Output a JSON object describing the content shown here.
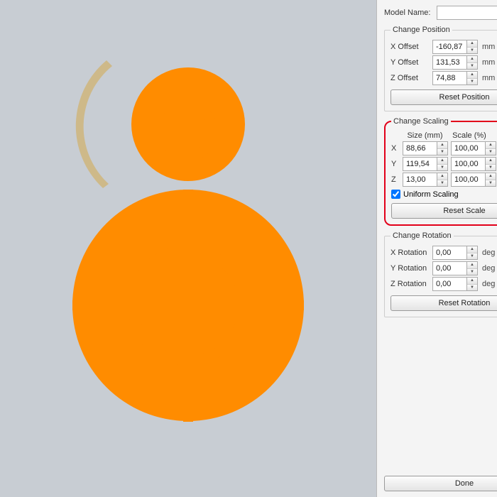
{
  "modelName": {
    "label": "Model Name:",
    "value": ""
  },
  "position": {
    "legend": "Change Position",
    "fields": [
      {
        "label": "X Offset",
        "value": "-160,87",
        "unit": "mm"
      },
      {
        "label": "Y Offset",
        "value": "131,53",
        "unit": "mm"
      },
      {
        "label": "Z Offset",
        "value": "74,88",
        "unit": "mm"
      }
    ],
    "reset": "Reset Position"
  },
  "scaling": {
    "legend": "Change Scaling",
    "sizeHdr": "Size (mm)",
    "scaleHdr": "Scale (%)",
    "rows": [
      {
        "axis": "X",
        "size": "88,66",
        "scale": "100,00"
      },
      {
        "axis": "Y",
        "size": "119,54",
        "scale": "100,00"
      },
      {
        "axis": "Z",
        "size": "13,00",
        "scale": "100,00"
      }
    ],
    "uniform": {
      "label": "Uniform Scaling",
      "checked": true
    },
    "reset": "Reset Scale"
  },
  "rotation": {
    "legend": "Change Rotation",
    "fields": [
      {
        "label": "X Rotation",
        "value": "0,00",
        "unit": "deg"
      },
      {
        "label": "Y Rotation",
        "value": "0,00",
        "unit": "deg"
      },
      {
        "label": "Z Rotation",
        "value": "0,00",
        "unit": "deg"
      }
    ],
    "reset": "Reset Rotation"
  },
  "done": "Done",
  "colors": {
    "outer": "#f7b500",
    "inner": "#ff8c00",
    "highlight": "#e2001a"
  }
}
